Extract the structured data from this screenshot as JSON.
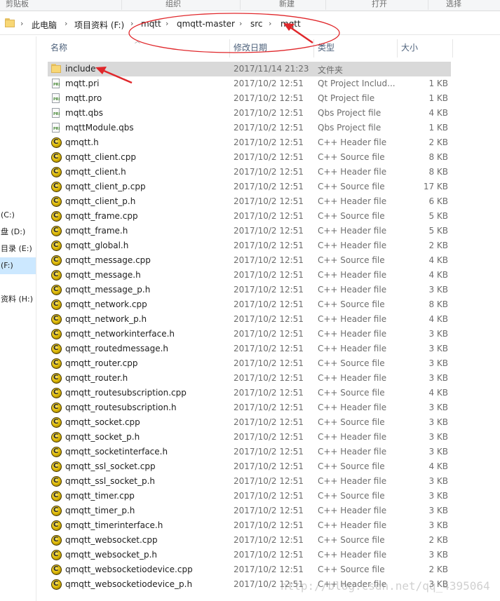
{
  "ribbon": {
    "groups": [
      "剪贴板",
      "组织",
      "新建",
      "打开",
      "选择"
    ]
  },
  "address": {
    "crumbs": [
      "此电脑",
      "项目资料 (F:)",
      "mqtt",
      "qmqtt-master",
      "src",
      "mqtt"
    ],
    "separator": "›"
  },
  "nav": {
    "items": [
      {
        "label": "(C:)",
        "selected": false
      },
      {
        "label": "盘 (D:)",
        "selected": false
      },
      {
        "label": "目录 (E:)",
        "selected": false
      },
      {
        "label": "(F:)",
        "selected": true
      },
      {
        "label": "资料 (H:)",
        "selected": false
      }
    ]
  },
  "columns": {
    "name": "名称",
    "date": "修改日期",
    "type": "类型",
    "size": "大小"
  },
  "files": [
    {
      "name": "include",
      "date": "2017/11/14 21:23",
      "type": "文件夹",
      "size": "",
      "icon": "folder-icon"
    },
    {
      "name": "mqtt.pri",
      "date": "2017/10/2 12:51",
      "type": "Qt Project Includ...",
      "size": "1 KB",
      "icon": "qt-project-file-icon"
    },
    {
      "name": "mqtt.pro",
      "date": "2017/10/2 12:51",
      "type": "Qt Project file",
      "size": "1 KB",
      "icon": "qt-project-file-icon"
    },
    {
      "name": "mqtt.qbs",
      "date": "2017/10/2 12:51",
      "type": "Qbs Project file",
      "size": "4 KB",
      "icon": "qt-project-file-icon"
    },
    {
      "name": "mqttModule.qbs",
      "date": "2017/10/2 12:51",
      "type": "Qbs Project file",
      "size": "1 KB",
      "icon": "qt-project-file-icon"
    },
    {
      "name": "qmqtt.h",
      "date": "2017/10/2 12:51",
      "type": "C++ Header file",
      "size": "2 KB",
      "icon": "cpp-file-icon"
    },
    {
      "name": "qmqtt_client.cpp",
      "date": "2017/10/2 12:51",
      "type": "C++ Source file",
      "size": "8 KB",
      "icon": "cpp-file-icon"
    },
    {
      "name": "qmqtt_client.h",
      "date": "2017/10/2 12:51",
      "type": "C++ Header file",
      "size": "8 KB",
      "icon": "cpp-file-icon"
    },
    {
      "name": "qmqtt_client_p.cpp",
      "date": "2017/10/2 12:51",
      "type": "C++ Source file",
      "size": "17 KB",
      "icon": "cpp-file-icon"
    },
    {
      "name": "qmqtt_client_p.h",
      "date": "2017/10/2 12:51",
      "type": "C++ Header file",
      "size": "6 KB",
      "icon": "cpp-file-icon"
    },
    {
      "name": "qmqtt_frame.cpp",
      "date": "2017/10/2 12:51",
      "type": "C++ Source file",
      "size": "5 KB",
      "icon": "cpp-file-icon"
    },
    {
      "name": "qmqtt_frame.h",
      "date": "2017/10/2 12:51",
      "type": "C++ Header file",
      "size": "5 KB",
      "icon": "cpp-file-icon"
    },
    {
      "name": "qmqtt_global.h",
      "date": "2017/10/2 12:51",
      "type": "C++ Header file",
      "size": "2 KB",
      "icon": "cpp-file-icon"
    },
    {
      "name": "qmqtt_message.cpp",
      "date": "2017/10/2 12:51",
      "type": "C++ Source file",
      "size": "4 KB",
      "icon": "cpp-file-icon"
    },
    {
      "name": "qmqtt_message.h",
      "date": "2017/10/2 12:51",
      "type": "C++ Header file",
      "size": "4 KB",
      "icon": "cpp-file-icon"
    },
    {
      "name": "qmqtt_message_p.h",
      "date": "2017/10/2 12:51",
      "type": "C++ Header file",
      "size": "3 KB",
      "icon": "cpp-file-icon"
    },
    {
      "name": "qmqtt_network.cpp",
      "date": "2017/10/2 12:51",
      "type": "C++ Source file",
      "size": "8 KB",
      "icon": "cpp-file-icon"
    },
    {
      "name": "qmqtt_network_p.h",
      "date": "2017/10/2 12:51",
      "type": "C++ Header file",
      "size": "4 KB",
      "icon": "cpp-file-icon"
    },
    {
      "name": "qmqtt_networkinterface.h",
      "date": "2017/10/2 12:51",
      "type": "C++ Header file",
      "size": "3 KB",
      "icon": "cpp-file-icon"
    },
    {
      "name": "qmqtt_routedmessage.h",
      "date": "2017/10/2 12:51",
      "type": "C++ Header file",
      "size": "3 KB",
      "icon": "cpp-file-icon"
    },
    {
      "name": "qmqtt_router.cpp",
      "date": "2017/10/2 12:51",
      "type": "C++ Source file",
      "size": "3 KB",
      "icon": "cpp-file-icon"
    },
    {
      "name": "qmqtt_router.h",
      "date": "2017/10/2 12:51",
      "type": "C++ Header file",
      "size": "3 KB",
      "icon": "cpp-file-icon"
    },
    {
      "name": "qmqtt_routesubscription.cpp",
      "date": "2017/10/2 12:51",
      "type": "C++ Source file",
      "size": "4 KB",
      "icon": "cpp-file-icon"
    },
    {
      "name": "qmqtt_routesubscription.h",
      "date": "2017/10/2 12:51",
      "type": "C++ Header file",
      "size": "3 KB",
      "icon": "cpp-file-icon"
    },
    {
      "name": "qmqtt_socket.cpp",
      "date": "2017/10/2 12:51",
      "type": "C++ Source file",
      "size": "3 KB",
      "icon": "cpp-file-icon"
    },
    {
      "name": "qmqtt_socket_p.h",
      "date": "2017/10/2 12:51",
      "type": "C++ Header file",
      "size": "3 KB",
      "icon": "cpp-file-icon"
    },
    {
      "name": "qmqtt_socketinterface.h",
      "date": "2017/10/2 12:51",
      "type": "C++ Header file",
      "size": "3 KB",
      "icon": "cpp-file-icon"
    },
    {
      "name": "qmqtt_ssl_socket.cpp",
      "date": "2017/10/2 12:51",
      "type": "C++ Source file",
      "size": "4 KB",
      "icon": "cpp-file-icon"
    },
    {
      "name": "qmqtt_ssl_socket_p.h",
      "date": "2017/10/2 12:51",
      "type": "C++ Header file",
      "size": "3 KB",
      "icon": "cpp-file-icon"
    },
    {
      "name": "qmqtt_timer.cpp",
      "date": "2017/10/2 12:51",
      "type": "C++ Source file",
      "size": "3 KB",
      "icon": "cpp-file-icon"
    },
    {
      "name": "qmqtt_timer_p.h",
      "date": "2017/10/2 12:51",
      "type": "C++ Header file",
      "size": "3 KB",
      "icon": "cpp-file-icon"
    },
    {
      "name": "qmqtt_timerinterface.h",
      "date": "2017/10/2 12:51",
      "type": "C++ Header file",
      "size": "3 KB",
      "icon": "cpp-file-icon"
    },
    {
      "name": "qmqtt_websocket.cpp",
      "date": "2017/10/2 12:51",
      "type": "C++ Source file",
      "size": "2 KB",
      "icon": "cpp-file-icon"
    },
    {
      "name": "qmqtt_websocket_p.h",
      "date": "2017/10/2 12:51",
      "type": "C++ Header file",
      "size": "3 KB",
      "icon": "cpp-file-icon"
    },
    {
      "name": "qmqtt_websocketiodevice.cpp",
      "date": "2017/10/2 12:51",
      "type": "C++ Source file",
      "size": "2 KB",
      "icon": "cpp-file-icon"
    },
    {
      "name": "qmqtt_websocketiodevice_p.h",
      "date": "2017/10/2 12:51",
      "type": "C++ Header file",
      "size": "3 KB",
      "icon": "cpp-file-icon"
    }
  ],
  "selected_file": "include",
  "watermark": "http://blog.csdn.net/qq_4395064",
  "colors": {
    "annotation": "#e0272b",
    "selection_row": "#d9d9d9",
    "nav_selection": "#cce8ff"
  }
}
